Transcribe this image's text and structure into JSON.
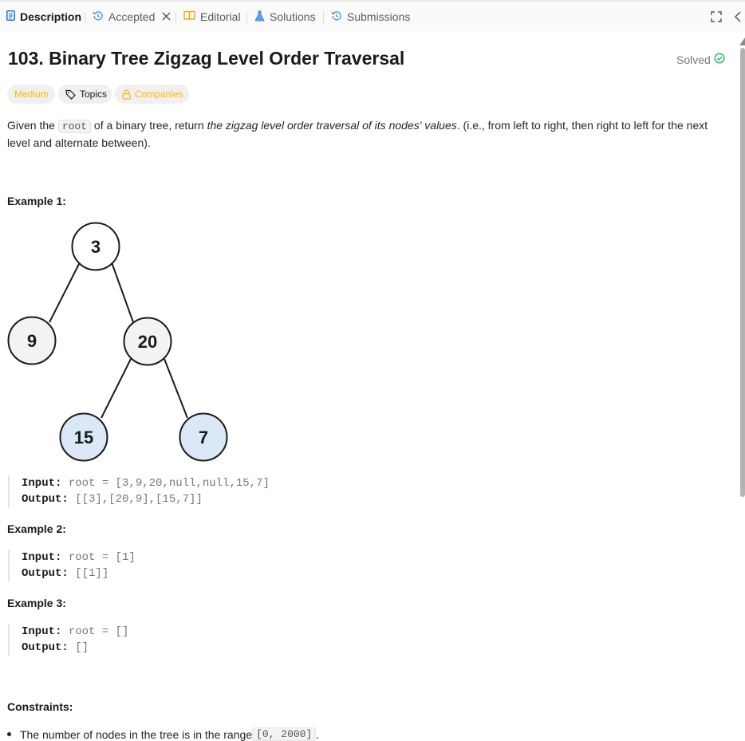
{
  "tabs": {
    "description": "Description",
    "accepted": "Accepted",
    "editorial": "Editorial",
    "solutions": "Solutions",
    "submissions": "Submissions"
  },
  "problem": {
    "title": "103. Binary Tree Zigzag Level Order Traversal",
    "status": "Solved",
    "difficulty": "Medium",
    "topics": "Topics",
    "companies": "Companies"
  },
  "description": {
    "p1": "Given the ",
    "code": "root",
    "p2": " of a binary tree, return ",
    "em": "the zigzag level order traversal of its nodes' values",
    "p3": ". (i.e., from left to right, then right to left for the next level and alternate between)."
  },
  "tree": {
    "root": "3",
    "left": "9",
    "right": "20",
    "right_left": "15",
    "right_right": "7"
  },
  "examples": [
    {
      "heading": "Example 1:",
      "input_label": "Input:",
      "input": " root = [3,9,20,null,null,15,7]",
      "output_label": "Output:",
      "output": " [[3],[20,9],[15,7]]"
    },
    {
      "heading": "Example 2:",
      "input_label": "Input:",
      "input": " root = [1]",
      "output_label": "Output:",
      "output": " [[1]]"
    },
    {
      "heading": "Example 3:",
      "input_label": "Input:",
      "input": " root = []",
      "output_label": "Output:",
      "output": " []"
    }
  ],
  "constraints": {
    "heading": "Constraints:",
    "item1_text": "The number of nodes in the tree is in the range ",
    "item1_code": "[0, 2000]",
    "item1_end": "."
  },
  "colors": {
    "accent_blue": "#1a73e8",
    "medium": "#ffb800",
    "solved_green": "#2cbb5d",
    "node_gray": "#f3f3f3",
    "node_blue": "#dbe8f8"
  }
}
